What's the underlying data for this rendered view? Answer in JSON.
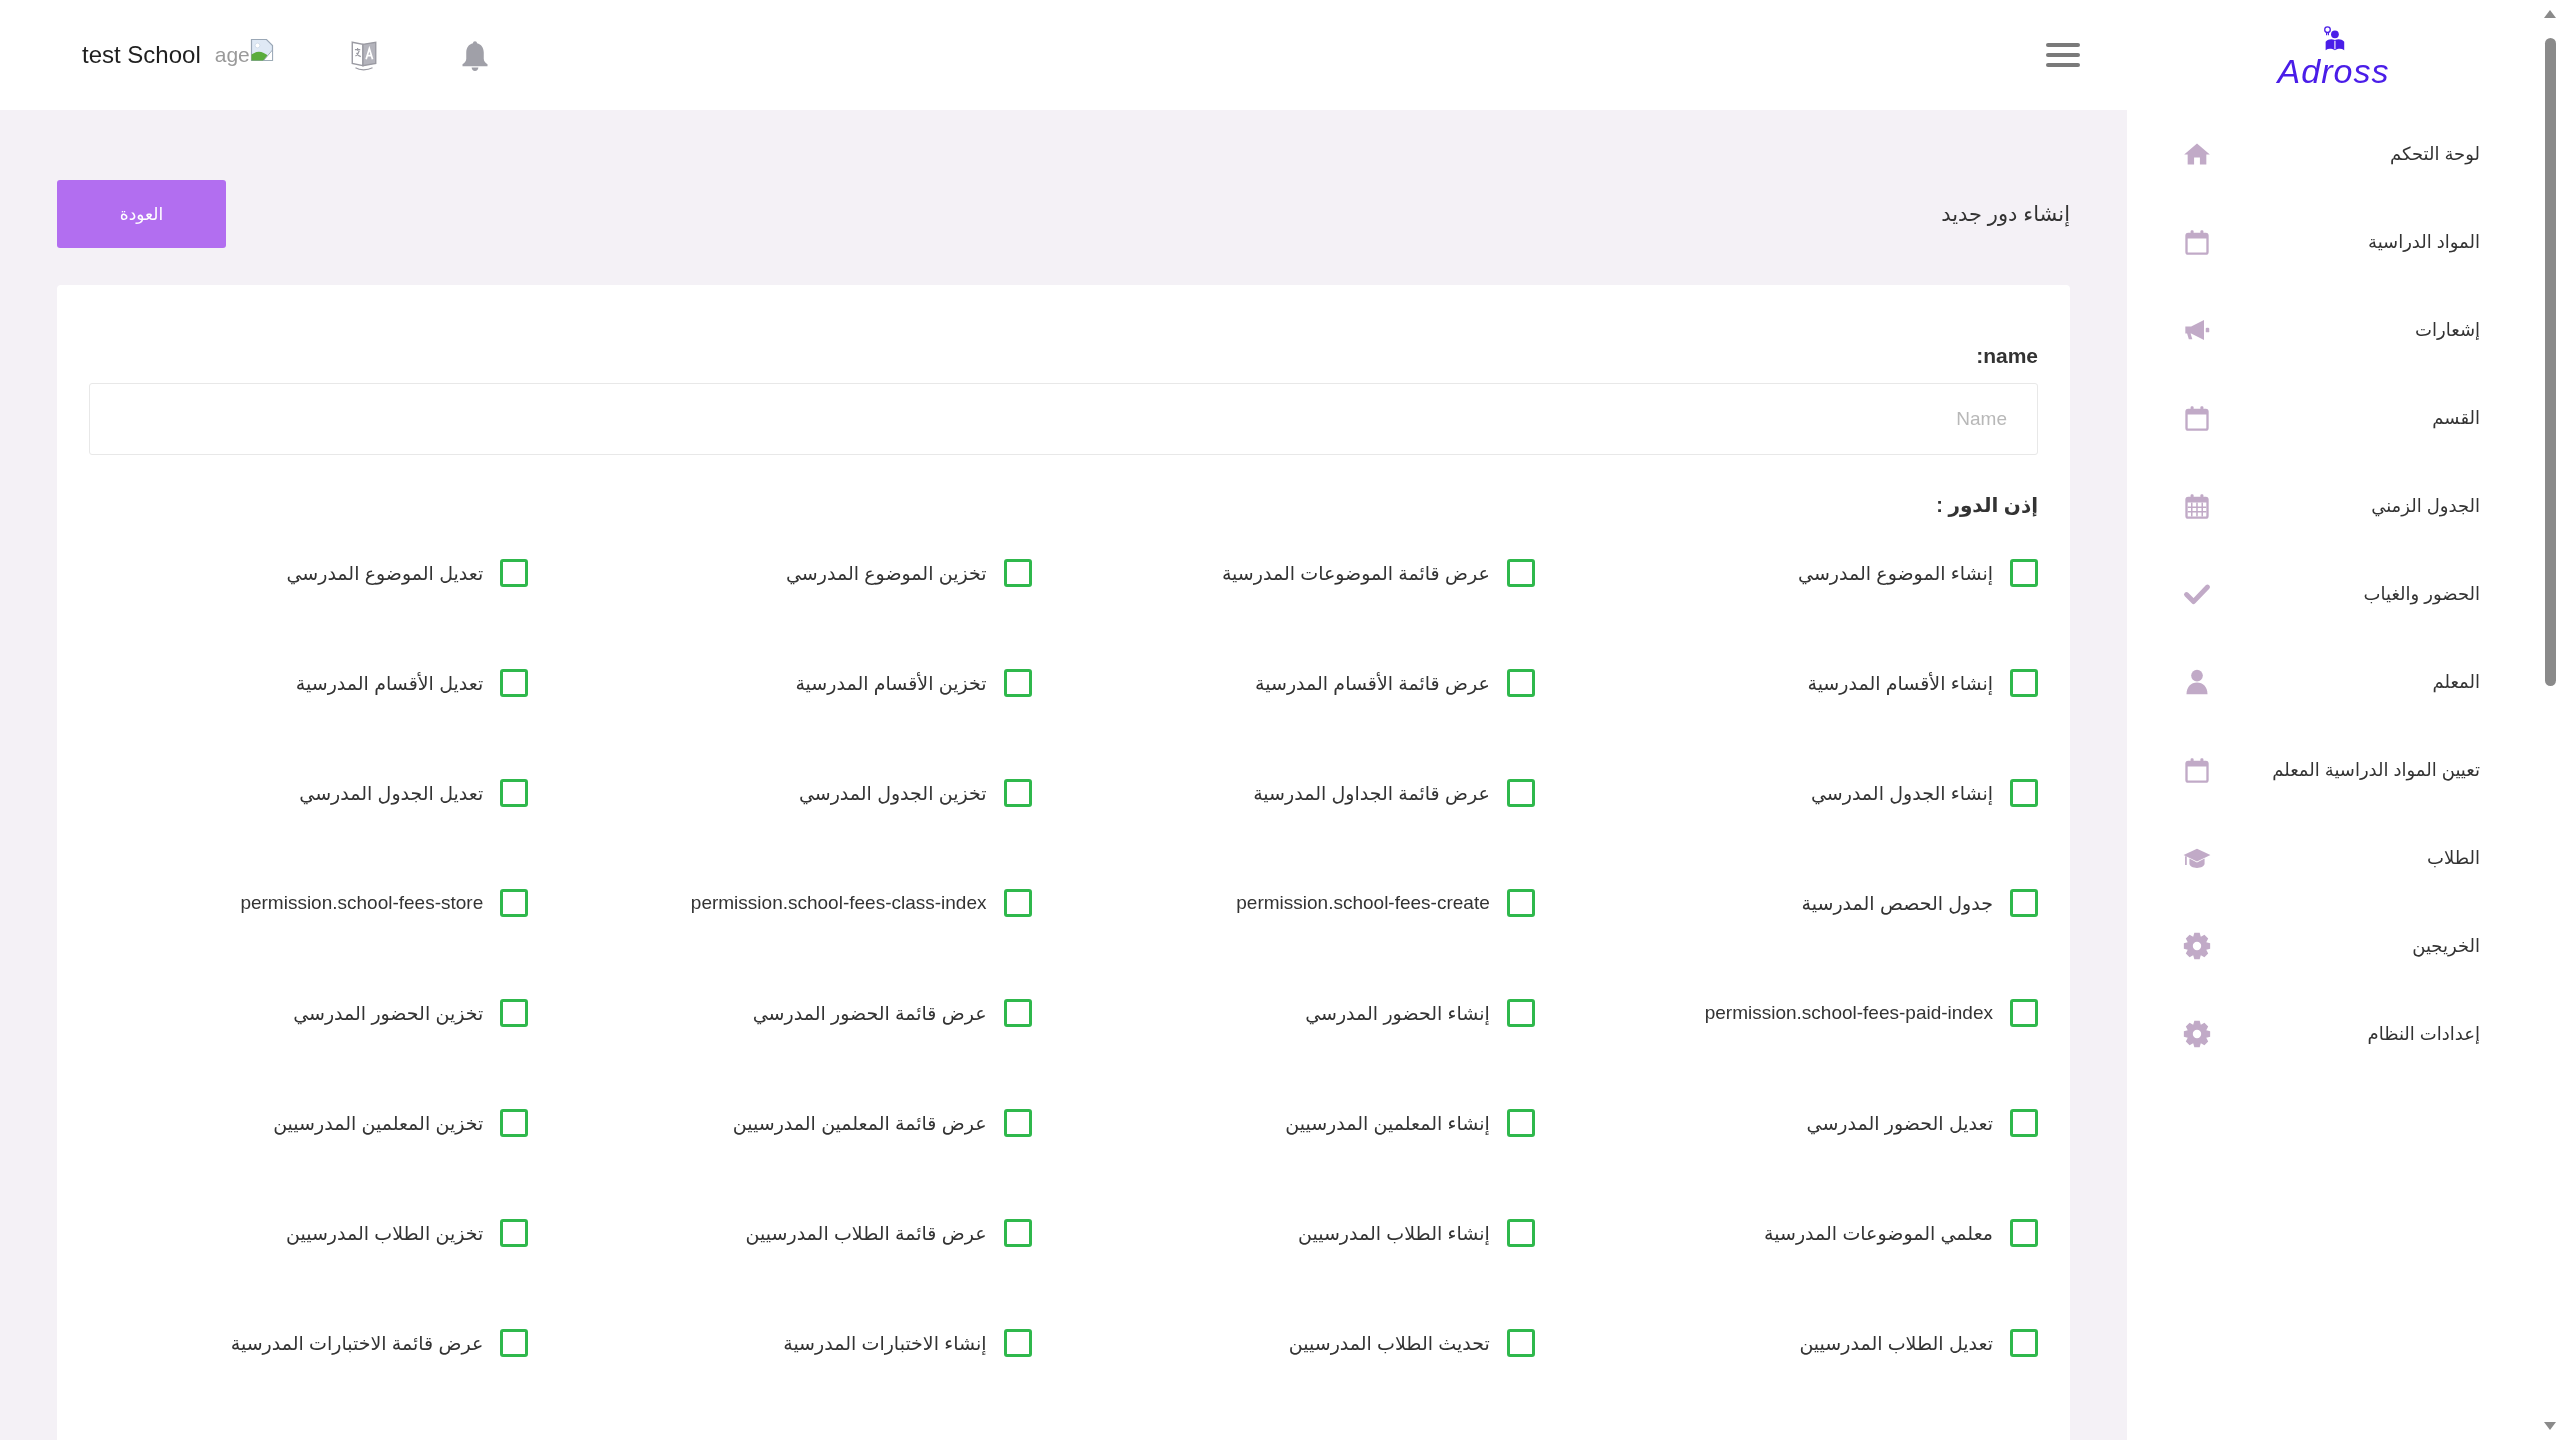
{
  "top_bar": {
    "school_name": "test School",
    "image_alt_text": "age"
  },
  "sidebar": {
    "logo_text": "Adross",
    "items": [
      {
        "label": "لوحة التحكم",
        "selected": false
      },
      {
        "label": "المواد الدراسية",
        "selected": false
      },
      {
        "label": "إشعارات",
        "selected": false
      },
      {
        "label": "القسم",
        "selected": false
      },
      {
        "label": "الجدول الزمني",
        "selected": false
      },
      {
        "label": "الحضور والغياب",
        "selected": false
      },
      {
        "label": "المعلم",
        "selected": false
      },
      {
        "label": "تعيين المواد الدراسية المعلم",
        "selected": false
      },
      {
        "label": "الطلاب",
        "selected": false
      },
      {
        "label": "الخريجين",
        "selected": false
      },
      {
        "label": "إعدادات النظام",
        "selected": false
      }
    ]
  },
  "page_header": {
    "title": "إنشاء دور جديد",
    "back_button": "العودة"
  },
  "form": {
    "name_label": ":name",
    "name_field": {
      "placeholder": "Name"
    },
    "permissions_label": "إذن الدور :",
    "permissions": [
      {
        "label": "إنشاء الموضوع المدرسي",
        "checked": false
      },
      {
        "label": "عرض قائمة الموضوعات المدرسية",
        "checked": false
      },
      {
        "label": "تخزين الموضوع المدرسي",
        "checked": false
      },
      {
        "label": "تعديل الموضوع المدرسي",
        "checked": false
      },
      {
        "label": "إنشاء الأقسام المدرسية",
        "checked": false
      },
      {
        "label": "عرض قائمة الأقسام المدرسية",
        "checked": false
      },
      {
        "label": "تخزين الأقسام المدرسية",
        "checked": false
      },
      {
        "label": "تعديل الأقسام المدرسية",
        "checked": false
      },
      {
        "label": "إنشاء الجدول المدرسي",
        "checked": false
      },
      {
        "label": "عرض قائمة الجداول المدرسية",
        "checked": false
      },
      {
        "label": "تخزين الجدول المدرسي",
        "checked": false
      },
      {
        "label": "تعديل الجدول المدرسي",
        "checked": false
      },
      {
        "label": "جدول الحصص المدرسية",
        "checked": false
      },
      {
        "label": "permission.school-fees-create",
        "checked": false
      },
      {
        "label": "permission.school-fees-class-index",
        "checked": false
      },
      {
        "label": "permission.school-fees-store",
        "checked": false
      },
      {
        "label": "permission.school-fees-paid-index",
        "checked": false
      },
      {
        "label": "إنشاء الحضور المدرسي",
        "checked": false
      },
      {
        "label": "عرض قائمة الحضور المدرسي",
        "checked": false
      },
      {
        "label": "تخزين الحضور المدرسي",
        "checked": false
      },
      {
        "label": "تعديل الحضور المدرسي",
        "checked": false
      },
      {
        "label": "إنشاء المعلمين المدرسيين",
        "checked": false
      },
      {
        "label": "عرض قائمة المعلمين المدرسيين",
        "checked": false
      },
      {
        "label": "تخزين المعلمين المدرسيين",
        "checked": false
      },
      {
        "label": "معلمي الموضوعات المدرسية",
        "checked": false
      },
      {
        "label": "إنشاء الطلاب المدرسيين",
        "checked": false
      },
      {
        "label": "عرض قائمة الطلاب المدرسيين",
        "checked": false
      },
      {
        "label": "تخزين الطلاب المدرسيين",
        "checked": false
      },
      {
        "label": "تعديل الطلاب المدرسيين",
        "checked": false
      },
      {
        "label": "تحديث الطلاب المدرسيين",
        "checked": false
      },
      {
        "label": "إنشاء الاختبارات المدرسية",
        "checked": false
      },
      {
        "label": "عرض قائمة الاختبارات المدرسية",
        "checked": false
      }
    ]
  }
}
